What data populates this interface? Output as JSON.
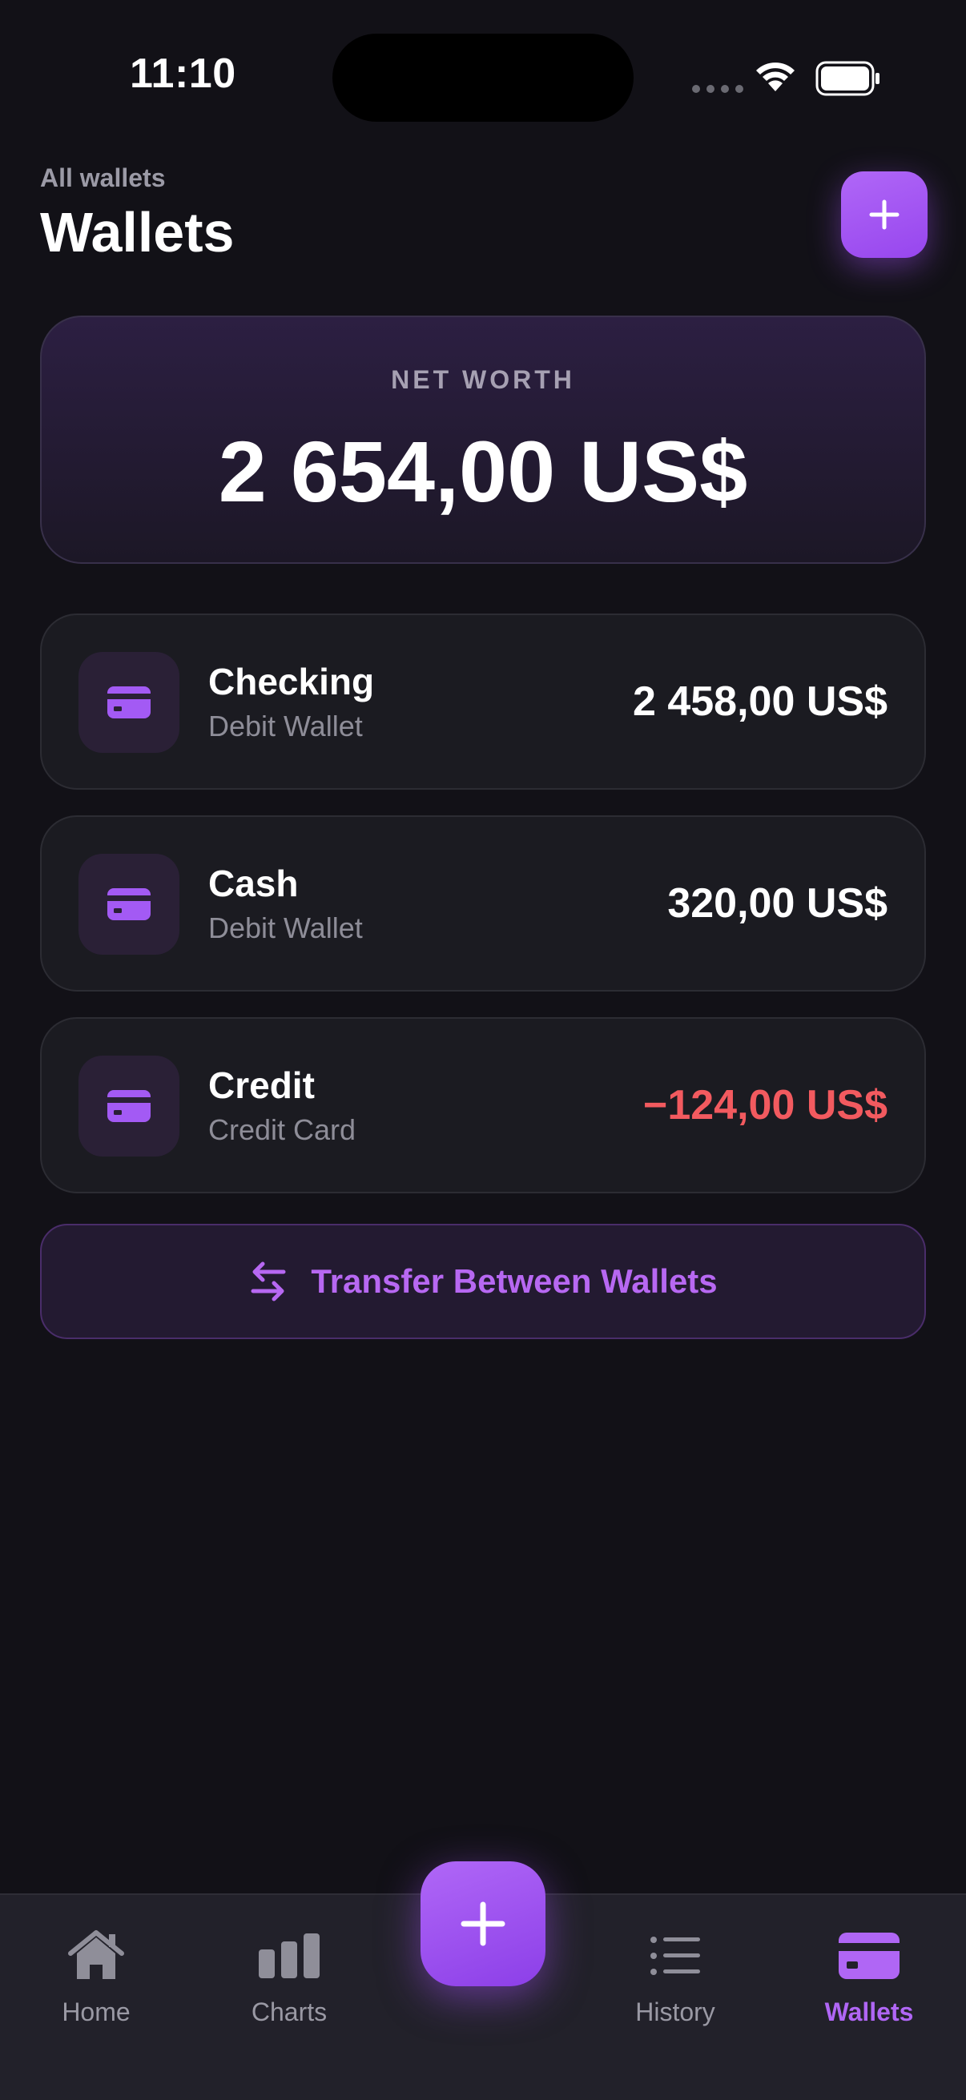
{
  "status": {
    "time": "11:10"
  },
  "header": {
    "eyebrow": "All wallets",
    "title": "Wallets"
  },
  "net_worth": {
    "label": "NET WORTH",
    "value": "2 654,00 US$"
  },
  "wallets": [
    {
      "name": "Checking",
      "type": "Debit Wallet",
      "amount": "2 458,00 US$",
      "icon": "card-icon"
    },
    {
      "name": "Cash",
      "type": "Debit Wallet",
      "amount": "320,00 US$",
      "icon": "card-icon"
    },
    {
      "name": "Credit",
      "type": "Credit Card",
      "amount": "−124,00 US$",
      "icon": "card-icon"
    }
  ],
  "transfer": {
    "label": "Transfer Between Wallets"
  },
  "tabs": [
    {
      "label": "Home",
      "icon": "home-icon"
    },
    {
      "label": "Charts",
      "icon": "bar-chart-icon"
    },
    {
      "label": "History",
      "icon": "list-icon"
    },
    {
      "label": "Wallets",
      "icon": "wallet-card-icon",
      "active": true
    }
  ],
  "colors": {
    "accent": "#a35af4",
    "negative": "#f25a5f",
    "background": "#121117",
    "card": "#1b1b21"
  }
}
